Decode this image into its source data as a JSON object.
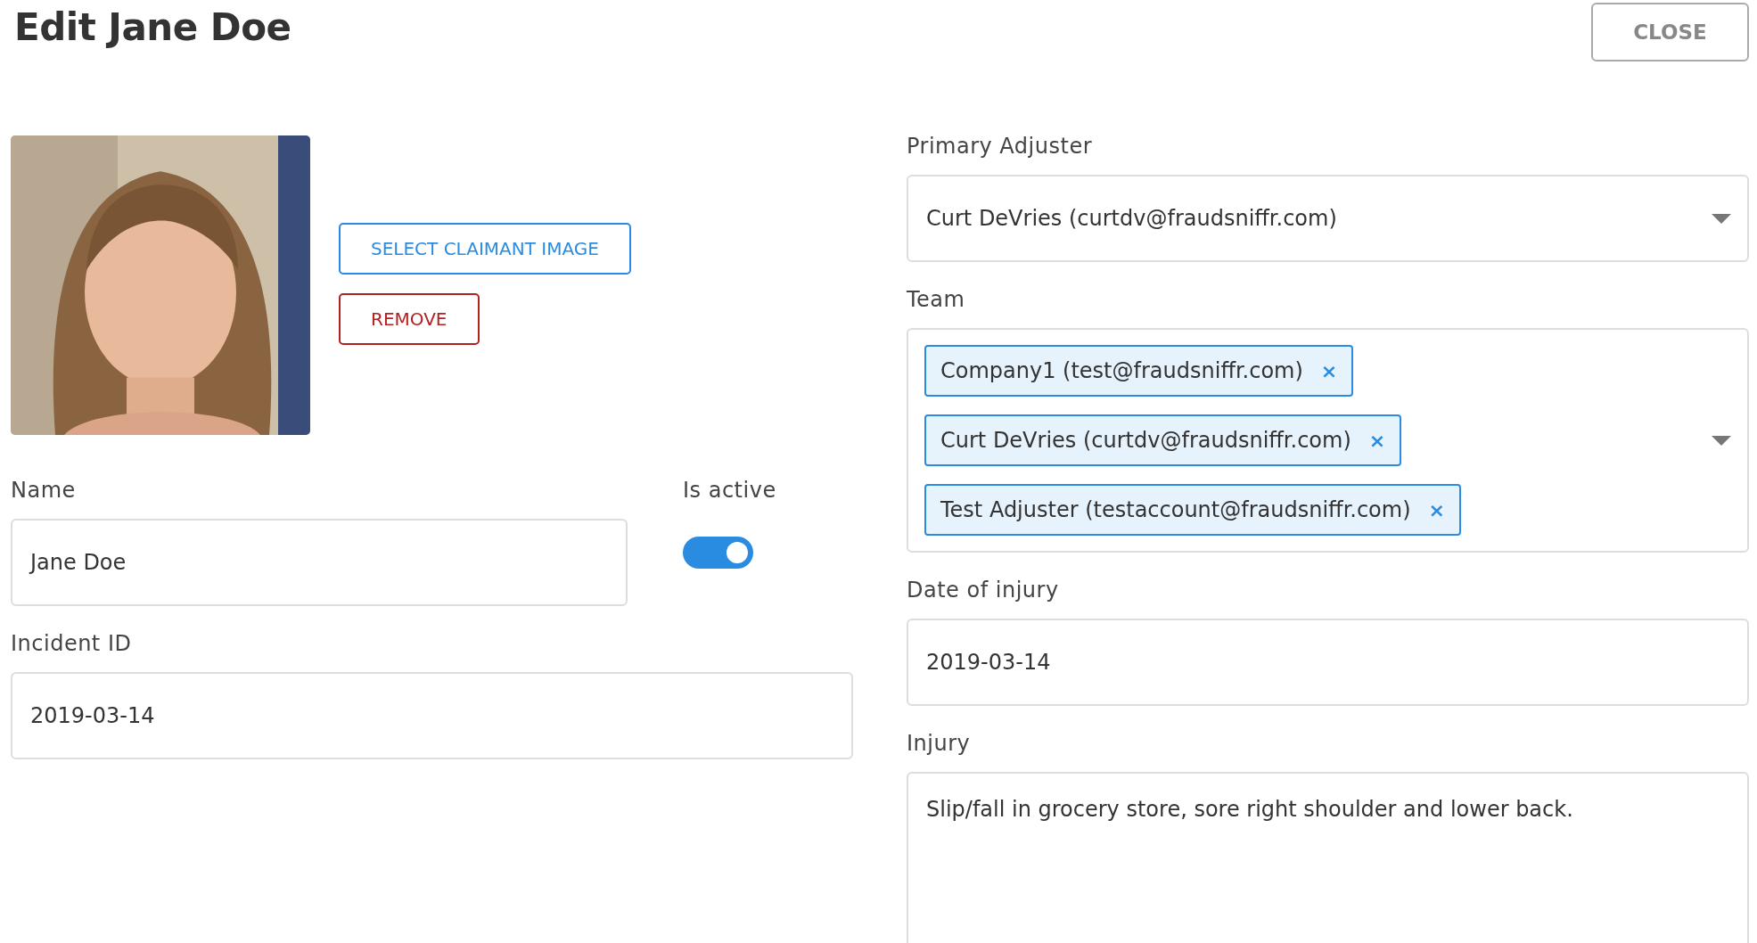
{
  "title": "Edit Jane Doe",
  "close_button": "CLOSE",
  "image_buttons": [
    {
      "label": "SELECT CLAIMANT IMAGE",
      "kind": "primary"
    },
    {
      "label": "REMOVE",
      "kind": "danger"
    }
  ],
  "primary_adjuster": {
    "label": "Primary Adjuster",
    "value": "Curt DeVries (curtdv@fraudsniffr.com)"
  },
  "team": {
    "label": "Team",
    "chips": [
      {
        "label": "Company1 (test@fraudsniffr.com)",
        "remove": "×"
      },
      {
        "label": "Curt DeVries (curtdv@fraudsniffr.com)",
        "remove": "×"
      },
      {
        "label": "Test Adjuster (testaccount@fraudsniffr.com)",
        "remove": "×"
      }
    ]
  },
  "name": {
    "label": "Name",
    "value": "Jane Doe"
  },
  "is_active": {
    "label": "Is active",
    "on": true
  },
  "date_of_injury": {
    "label": "Date of injury",
    "value": "2019-03-14"
  },
  "incident_id": {
    "label": "Incident ID",
    "value": "2019-03-14"
  },
  "injury": {
    "label": "Injury",
    "value": "Slip/fall in grocery store, sore right shoulder and lower back."
  }
}
